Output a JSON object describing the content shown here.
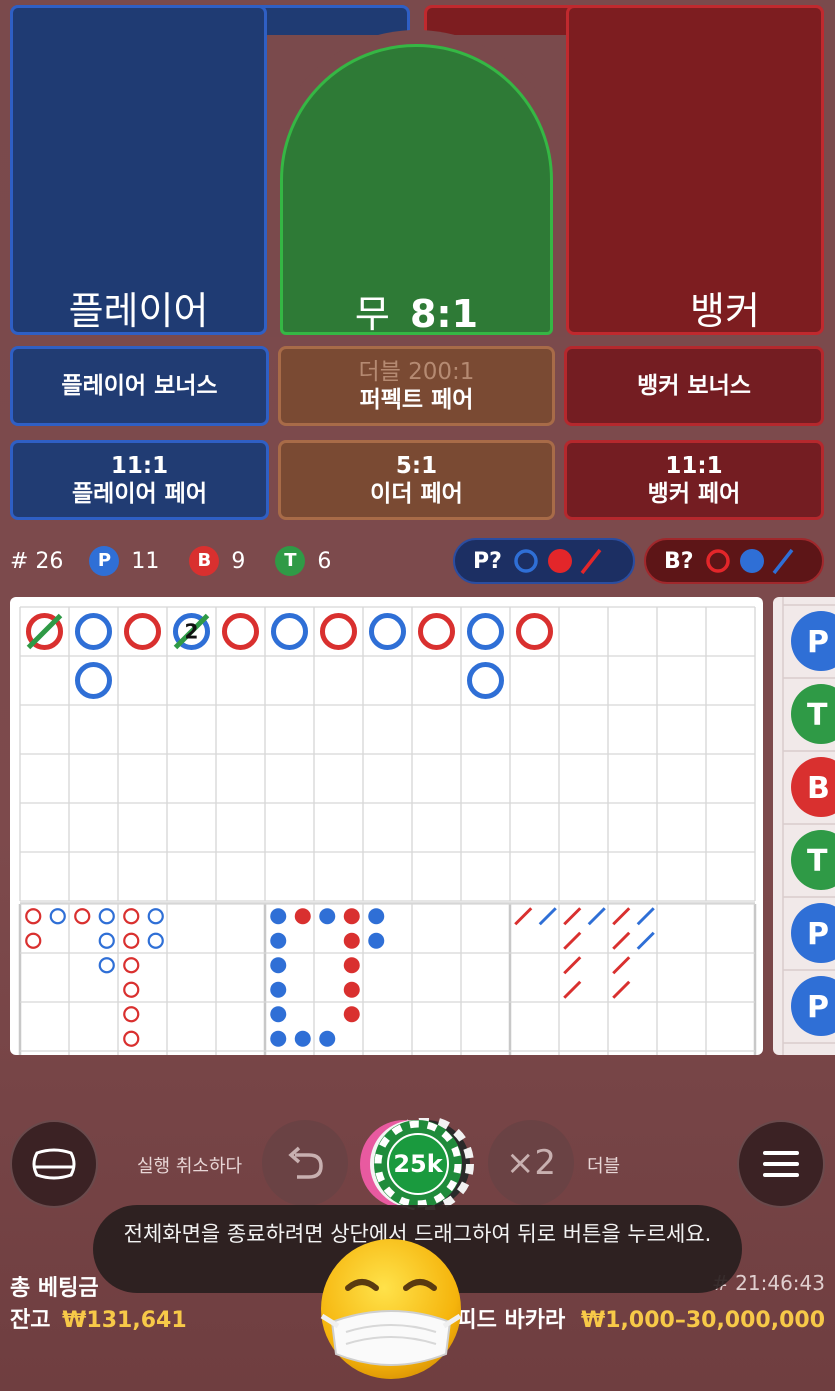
{
  "main_bets": {
    "player": "플레이어",
    "tie_label": "무",
    "tie_odds": "8:1",
    "banker": "뱅커"
  },
  "side_bets": {
    "player_bonus": "플레이어 보너스",
    "perfect_pair_odds": "더블 200:1",
    "perfect_pair": "퍼펙트 페어",
    "banker_bonus": "뱅커 보너스",
    "player_pair_odds": "11:1",
    "player_pair": "플레이어 페어",
    "either_pair_odds": "5:1",
    "either_pair": "이더 페어",
    "banker_pair_odds": "11:1",
    "banker_pair": "뱅커 페어"
  },
  "stats": {
    "round": "# 26",
    "p_letter": "P",
    "p_count": "11",
    "b_letter": "B",
    "b_count": "9",
    "t_letter": "T",
    "t_count": "6",
    "player_ask": "P?",
    "banker_ask": "B?"
  },
  "big_road": [
    {
      "col": 0,
      "row": 0,
      "side": "B",
      "tie": true
    },
    {
      "col": 1,
      "row": 0,
      "side": "P"
    },
    {
      "col": 1,
      "row": 1,
      "side": "P"
    },
    {
      "col": 2,
      "row": 0,
      "side": "B"
    },
    {
      "col": 3,
      "row": 0,
      "side": "P",
      "tie": true,
      "tie_count": "2"
    },
    {
      "col": 4,
      "row": 0,
      "side": "B"
    },
    {
      "col": 5,
      "row": 0,
      "side": "P"
    },
    {
      "col": 6,
      "row": 0,
      "side": "B"
    },
    {
      "col": 7,
      "row": 0,
      "side": "P"
    },
    {
      "col": 8,
      "row": 0,
      "side": "B"
    },
    {
      "col": 9,
      "row": 0,
      "side": "P"
    },
    {
      "col": 9,
      "row": 1,
      "side": "P"
    },
    {
      "col": 10,
      "row": 0,
      "side": "B"
    }
  ],
  "big_eye_road": [
    {
      "c": 0,
      "r": 0,
      "k": "R"
    },
    {
      "c": 1,
      "r": 0,
      "k": "B"
    },
    {
      "c": 2,
      "r": 0,
      "k": "R"
    },
    {
      "c": 3,
      "r": 0,
      "k": "B"
    },
    {
      "c": 4,
      "r": 0,
      "k": "R"
    },
    {
      "c": 5,
      "r": 0,
      "k": "B"
    },
    {
      "c": 0,
      "r": 1,
      "k": "R"
    },
    {
      "c": 3,
      "r": 1,
      "k": "B"
    },
    {
      "c": 4,
      "r": 1,
      "k": "R"
    },
    {
      "c": 5,
      "r": 1,
      "k": "B"
    },
    {
      "c": 3,
      "r": 2,
      "k": "B"
    },
    {
      "c": 4,
      "r": 2,
      "k": "R"
    },
    {
      "c": 4,
      "r": 3,
      "k": "R"
    },
    {
      "c": 4,
      "r": 4,
      "k": "R"
    },
    {
      "c": 4,
      "r": 5,
      "k": "R"
    }
  ],
  "small_road": [
    {
      "c": 0,
      "r": 0,
      "k": "B"
    },
    {
      "c": 1,
      "r": 0,
      "k": "R"
    },
    {
      "c": 2,
      "r": 0,
      "k": "B"
    },
    {
      "c": 3,
      "r": 0,
      "k": "R"
    },
    {
      "c": 4,
      "r": 0,
      "k": "B"
    },
    {
      "c": 0,
      "r": 1,
      "k": "B"
    },
    {
      "c": 3,
      "r": 1,
      "k": "R"
    },
    {
      "c": 4,
      "r": 1,
      "k": "B"
    },
    {
      "c": 0,
      "r": 2,
      "k": "B"
    },
    {
      "c": 3,
      "r": 2,
      "k": "R"
    },
    {
      "c": 0,
      "r": 3,
      "k": "B"
    },
    {
      "c": 3,
      "r": 3,
      "k": "R"
    },
    {
      "c": 0,
      "r": 4,
      "k": "B"
    },
    {
      "c": 3,
      "r": 4,
      "k": "R"
    },
    {
      "c": 0,
      "r": 5,
      "k": "B"
    },
    {
      "c": 1,
      "r": 5,
      "k": "B"
    },
    {
      "c": 2,
      "r": 5,
      "k": "B"
    }
  ],
  "cockroach_road": [
    {
      "c": 0,
      "r": 0,
      "k": "R"
    },
    {
      "c": 1,
      "r": 0,
      "k": "B"
    },
    {
      "c": 2,
      "r": 0,
      "k": "R"
    },
    {
      "c": 3,
      "r": 0,
      "k": "B"
    },
    {
      "c": 4,
      "r": 0,
      "k": "R"
    },
    {
      "c": 5,
      "r": 0,
      "k": "B"
    },
    {
      "c": 2,
      "r": 1,
      "k": "R"
    },
    {
      "c": 4,
      "r": 1,
      "k": "R"
    },
    {
      "c": 5,
      "r": 1,
      "k": "B"
    },
    {
      "c": 2,
      "r": 2,
      "k": "R"
    },
    {
      "c": 4,
      "r": 2,
      "k": "R"
    },
    {
      "c": 2,
      "r": 3,
      "k": "R"
    },
    {
      "c": 4,
      "r": 3,
      "k": "R"
    }
  ],
  "bead_peek": [
    {
      "letter": "P",
      "color": "#2f6fd6"
    },
    {
      "letter": "T",
      "color": "#2f9a46"
    },
    {
      "letter": "B",
      "color": "#d9302f"
    },
    {
      "letter": "T",
      "color": "#2f9a46"
    },
    {
      "letter": "P",
      "color": "#2f6fd6"
    },
    {
      "letter": "P",
      "color": "#2f6fd6"
    }
  ],
  "controls": {
    "undo_label": "실행 취소하다",
    "chip_value": "25k",
    "double_symbol": "×2",
    "double_label": "더블"
  },
  "toast": {
    "text": "전체화면을 종료하려면 상단에서 드래그하여 뒤로 버튼을 누르세요."
  },
  "footer": {
    "total_bet_label": "총 베팅금",
    "balance_label": "잔고",
    "balance_value": "₩131,641",
    "time": "# 21:46:43",
    "game_name": "피드 바카라",
    "limits": "₩1,000–30,000,000"
  },
  "colors": {
    "player_blue": "#2f6fd6",
    "banker_red": "#d9302f",
    "tie_green": "#2f9a46"
  }
}
